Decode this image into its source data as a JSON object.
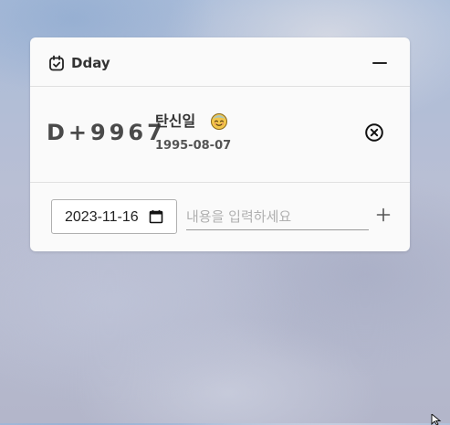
{
  "widget": {
    "title": "Dday",
    "header_icon": "calendar-check-icon",
    "minimize_icon": "minus-icon"
  },
  "entry": {
    "dday": "D+9967",
    "name": "탄신일",
    "emoji": "smiling-face-emoji",
    "date": "1995-08-07",
    "delete_icon": "circle-x-icon"
  },
  "form": {
    "date_value": "2023-11-16",
    "date_picker_icon": "calendar-icon",
    "content_placeholder": "내용을 입력하세요",
    "add_icon": "plus-icon"
  }
}
